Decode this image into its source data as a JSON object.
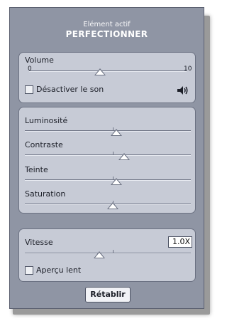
{
  "header": {
    "subtitle": "Elément actif",
    "title": "PERFECTIONNER"
  },
  "volume": {
    "label": "Volume",
    "min_label": "0",
    "max_label": "10",
    "value": 4.5,
    "mute_label": "Désactiver le son",
    "mute_checked": false
  },
  "image": {
    "brightness_label": "Luminosité",
    "brightness_value": 0.55,
    "contrast_label": "Contraste",
    "contrast_value": 0.6,
    "hue_label": "Teinte",
    "hue_value": 0.55,
    "saturation_label": "Saturation",
    "saturation_value": 0.53
  },
  "speed": {
    "label": "Vitesse",
    "value_text": "1.0X",
    "value": 0.45,
    "slow_preview_label": "Aperçu lent",
    "slow_preview_checked": false
  },
  "reset_label": "Rétablir",
  "icons": {
    "speaker": "speaker-icon"
  }
}
